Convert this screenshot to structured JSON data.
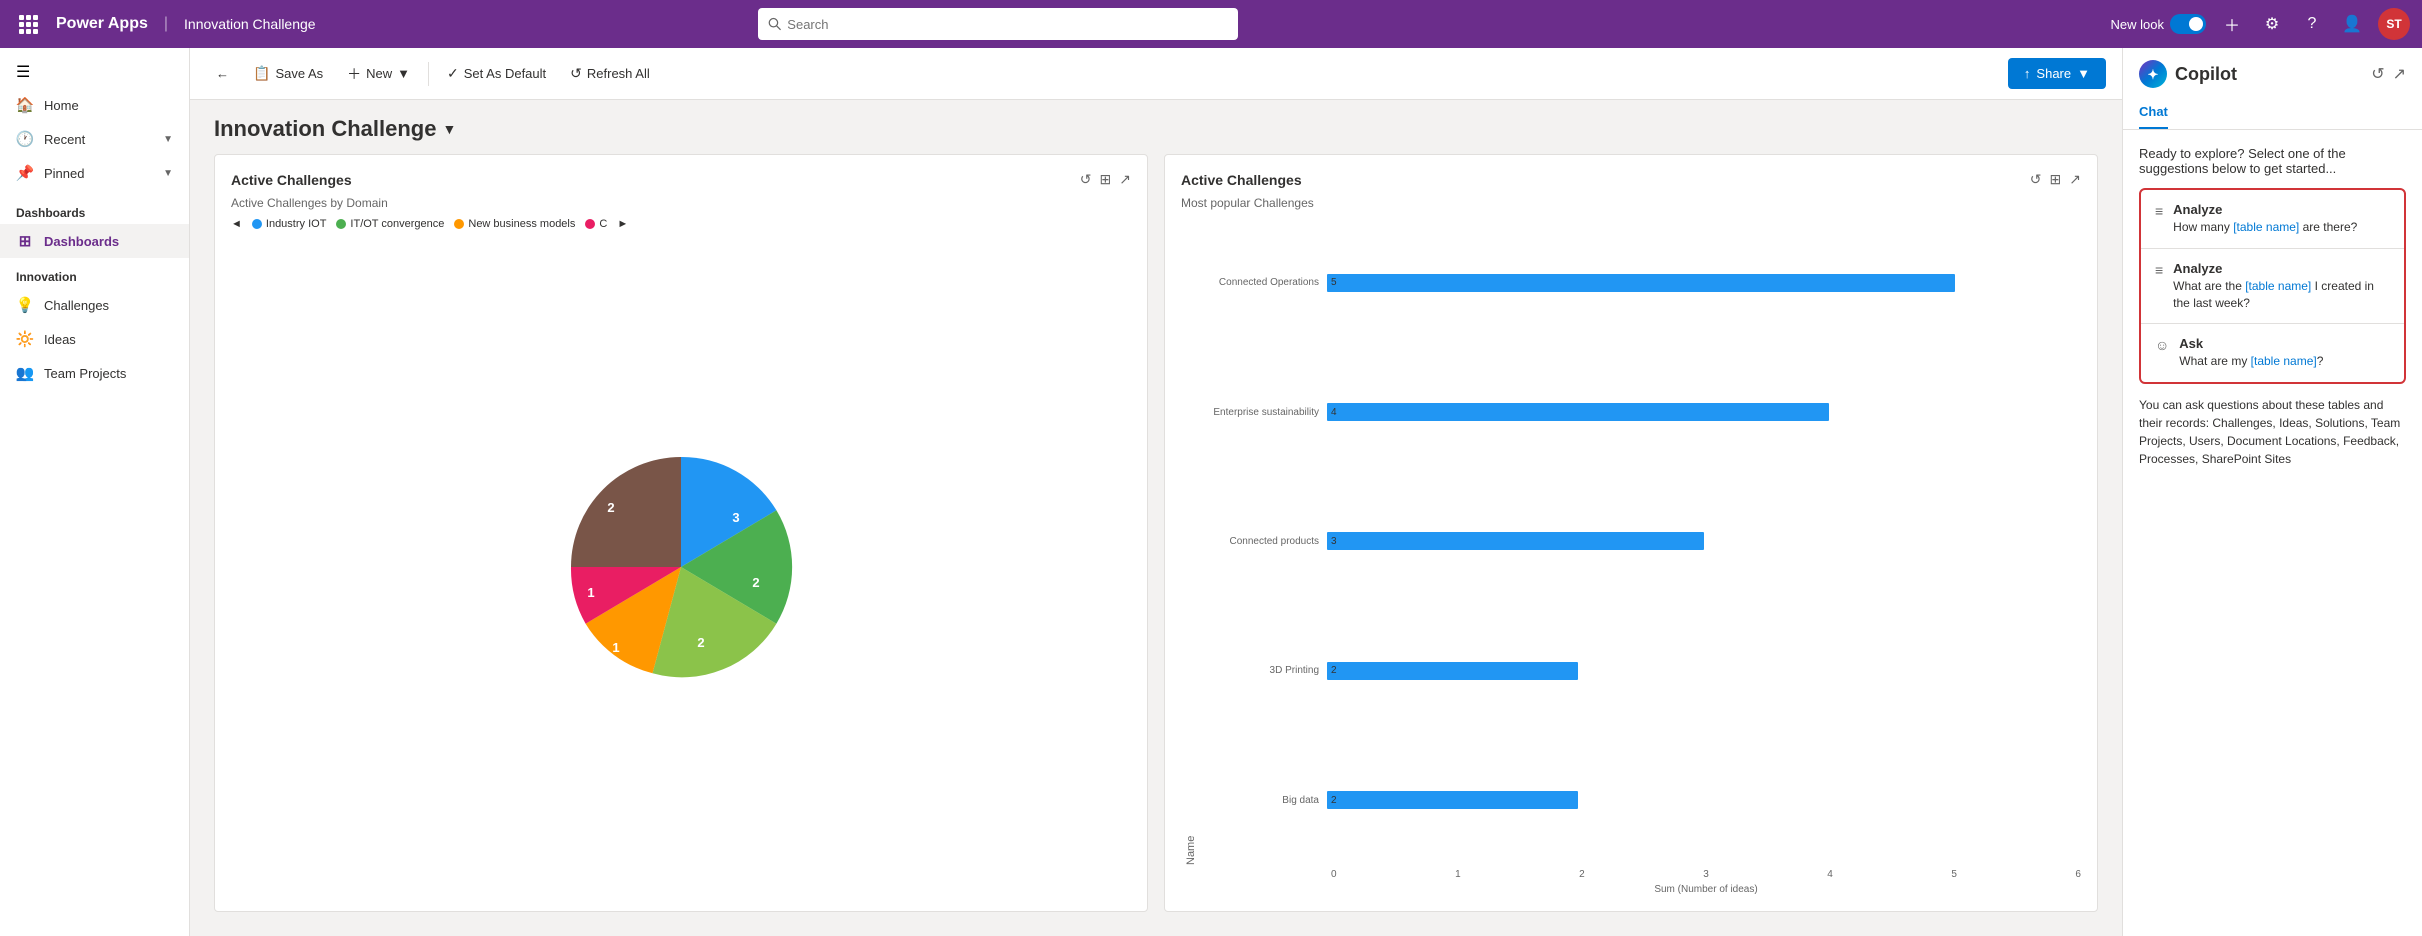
{
  "topNav": {
    "brand": "Power Apps",
    "divider": "|",
    "appName": "Innovation Challenge",
    "searchPlaceholder": "Search",
    "newLook": "New look",
    "avatarInitials": "ST"
  },
  "toolbar": {
    "back": "‹",
    "saveAs": "Save As",
    "new": "New",
    "setAsDefault": "Set As Default",
    "refreshAll": "Refresh All",
    "share": "Share"
  },
  "pageTitle": "Innovation Challenge",
  "sidebar": {
    "collapseIcon": "☰",
    "homeLabel": "Home",
    "recentLabel": "Recent",
    "pinnedLabel": "Pinned",
    "dashboardsSectionLabel": "Dashboards",
    "dashboardsItem": "Dashboards",
    "innovationSectionLabel": "Innovation",
    "challengesLabel": "Challenges",
    "ideasLabel": "Ideas",
    "teamProjectsLabel": "Team Projects"
  },
  "leftCard": {
    "title": "Active Challenges",
    "subtitle": "Active Challenges by Domain",
    "legendItems": [
      {
        "label": "Industry IOT",
        "color": "#2196f3"
      },
      {
        "label": "IT/OT convergence",
        "color": "#4caf50"
      },
      {
        "label": "New business models",
        "color": "#ff9800"
      },
      {
        "label": "C",
        "color": "#e91e63"
      }
    ],
    "pieSlices": [
      {
        "label": "3",
        "color": "#2196f3",
        "value": 3
      },
      {
        "label": "2",
        "color": "#4caf50",
        "value": 2
      },
      {
        "label": "2",
        "color": "#8bc34a",
        "value": 2
      },
      {
        "label": "1",
        "color": "#ff9800",
        "value": 1
      },
      {
        "label": "1",
        "color": "#e91e63",
        "value": 1
      },
      {
        "label": "2",
        "color": "#795548",
        "value": 2
      }
    ]
  },
  "rightCard": {
    "title": "Active Challenges",
    "subtitle": "Most popular Challenges",
    "bars": [
      {
        "label": "Connected Operations",
        "value": 5,
        "max": 6
      },
      {
        "label": "Enterprise sustainability",
        "value": 4,
        "max": 6
      },
      {
        "label": "Connected products",
        "value": 3,
        "max": 6
      },
      {
        "label": "3D Printing",
        "value": 2,
        "max": 6
      },
      {
        "label": "Big data",
        "value": 2,
        "max": 6
      }
    ],
    "xAxisLabels": [
      "0",
      "1",
      "2",
      "3",
      "4",
      "5",
      "6"
    ],
    "xAxisTitle": "Sum (Number of ideas)",
    "yAxisTitle": "Name"
  },
  "copilot": {
    "title": "Copilot",
    "tab": "Chat",
    "intro": "Ready to explore? Select one of the suggestions below to get started...",
    "suggestions": [
      {
        "icon": "≡",
        "title": "Analyze",
        "text": "How many [table name] are there?"
      },
      {
        "icon": "≡",
        "title": "Analyze",
        "text": "What are the [table name] I created in the last week?"
      },
      {
        "icon": "☺",
        "title": "Ask",
        "text": "What are my [table name]?"
      }
    ],
    "footer": "You can ask questions about these tables and their records: Challenges, Ideas, Solutions, Team Projects, Users, Document Locations, Feedback, Processes, SharePoint Sites"
  }
}
